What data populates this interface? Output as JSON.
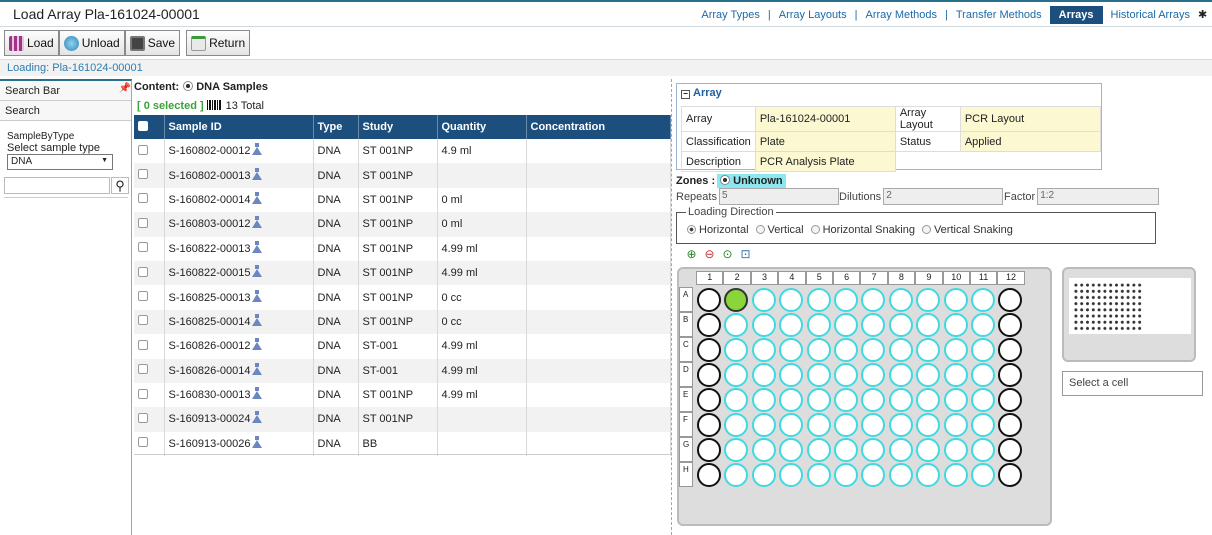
{
  "header": {
    "title": "Load Array Pla-161024-00001",
    "nav": [
      {
        "label": "Array Types",
        "active": false
      },
      {
        "label": "Array Layouts",
        "active": false
      },
      {
        "label": "Array Methods",
        "active": false
      },
      {
        "label": "Transfer Methods",
        "active": false
      },
      {
        "label": "Arrays",
        "active": true
      },
      {
        "label": "Historical Arrays",
        "active": false
      }
    ]
  },
  "toolbar": {
    "load": "Load",
    "unload": "Unload",
    "save": "Save",
    "return": "Return"
  },
  "loading_text": "Loading: Pla-161024-00001",
  "left_panel": {
    "search_bar": "Search Bar",
    "search": "Search",
    "group_legend": "SampleByType",
    "select_label": "Select sample type",
    "select_value": "DNA"
  },
  "content": {
    "label": "Content:",
    "option": "DNA Samples",
    "selected": "[ 0 selected ]",
    "total": "13 Total"
  },
  "table": {
    "headers": [
      "Sample ID",
      "Type",
      "Study",
      "Quantity",
      "Concentration"
    ],
    "rows": [
      {
        "id": "S-160802-00012",
        "type": "DNA",
        "study": "ST 001NP",
        "qty": "4.9 ml",
        "conc": ""
      },
      {
        "id": "S-160802-00013",
        "type": "DNA",
        "study": "ST 001NP",
        "qty": "",
        "conc": ""
      },
      {
        "id": "S-160802-00014",
        "type": "DNA",
        "study": "ST 001NP",
        "qty": "0 ml",
        "conc": ""
      },
      {
        "id": "S-160803-00012",
        "type": "DNA",
        "study": "ST 001NP",
        "qty": "0 ml",
        "conc": ""
      },
      {
        "id": "S-160822-00013",
        "type": "DNA",
        "study": "ST 001NP",
        "qty": "4.99 ml",
        "conc": ""
      },
      {
        "id": "S-160822-00015",
        "type": "DNA",
        "study": "ST 001NP",
        "qty": "4.99 ml",
        "conc": ""
      },
      {
        "id": "S-160825-00013",
        "type": "DNA",
        "study": "ST 001NP",
        "qty": "0 cc",
        "conc": ""
      },
      {
        "id": "S-160825-00014",
        "type": "DNA",
        "study": "ST 001NP",
        "qty": "0 cc",
        "conc": ""
      },
      {
        "id": "S-160826-00012",
        "type": "DNA",
        "study": "ST-001",
        "qty": "4.99 ml",
        "conc": ""
      },
      {
        "id": "S-160826-00014",
        "type": "DNA",
        "study": "ST-001",
        "qty": "4.99 ml",
        "conc": ""
      },
      {
        "id": "S-160830-00013",
        "type": "DNA",
        "study": "ST 001NP",
        "qty": "4.99 ml",
        "conc": ""
      },
      {
        "id": "S-160913-00024",
        "type": "DNA",
        "study": "ST 001NP",
        "qty": "",
        "conc": ""
      },
      {
        "id": "S-160913-00026",
        "type": "DNA",
        "study": "BB",
        "qty": "",
        "conc": ""
      }
    ]
  },
  "array_panel": {
    "title": "Array",
    "array_label": "Array",
    "array_value": "Pla-161024-00001",
    "layout_label": "Array Layout",
    "layout_value": "PCR Layout",
    "class_label": "Classification",
    "class_value": "Plate",
    "status_label": "Status",
    "status_value": "Applied",
    "desc_label": "Description",
    "desc_value": "PCR Analysis Plate"
  },
  "zones": {
    "label": "Zones :",
    "value": "Unknown"
  },
  "params": {
    "repeats_label": "Repeats",
    "repeats_value": "5",
    "dilutions_label": "Dilutions",
    "dilutions_value": "2",
    "factor_label": "Factor",
    "factor_value": "1:2"
  },
  "loading_direction": {
    "legend": "Loading Direction",
    "options": [
      {
        "label": "Horizontal",
        "selected": true
      },
      {
        "label": "Vertical",
        "selected": false
      },
      {
        "label": "Horizontal Snaking",
        "selected": false
      },
      {
        "label": "Vertical Snaking",
        "selected": false
      }
    ]
  },
  "plate": {
    "columns": [
      "1",
      "2",
      "3",
      "4",
      "5",
      "6",
      "7",
      "8",
      "9",
      "10",
      "11",
      "12"
    ],
    "rows": [
      "A",
      "B",
      "C",
      "D",
      "E",
      "F",
      "G",
      "H"
    ],
    "filled_well": "A2"
  },
  "cell_info": "Select a cell",
  "colors": {
    "accent": "#1c4f7e",
    "well_ring": "#40d9e0",
    "well_filled": "#8ad63a",
    "selected_count": "#3aa33a"
  }
}
